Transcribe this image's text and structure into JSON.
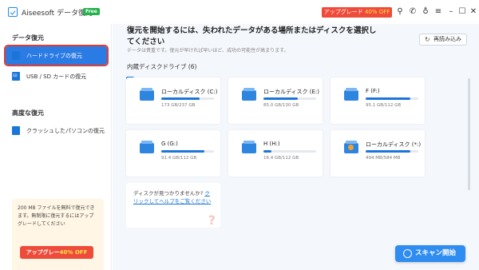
{
  "titlebar": {
    "app_title": "Aiseesoft データ復元",
    "free_badge": "Free",
    "upgrade_main": "アップグレード",
    "upgrade_offer": "40% OFF"
  },
  "sidebar": {
    "data_recovery_heading": "データ復元",
    "items": [
      {
        "label": "ハードドライブの復元",
        "icon": "hard-drive-icon"
      },
      {
        "label": "USB / SD カードの復元",
        "icon": "sd-card-icon"
      }
    ],
    "advanced_heading": "高度な復元",
    "advanced_items": [
      {
        "label": "クラッシュしたパソコンの復元",
        "icon": "crashed-pc-icon"
      }
    ],
    "promo": {
      "text": "200 MB ファイルを無料で復元できます。無制限に復元するにはアップグレードしてください",
      "button_main": "アップグレー",
      "button_offer": "40% OFF"
    }
  },
  "main": {
    "title": "復元を開始するには、失われたデータがある場所またはディスクを選択してください",
    "subtitle": "データは貴重です。復元が早ければ早いほど、成功の可能性が高まります。",
    "rescan_label": "再読み込み",
    "section_label": "内蔵ディスクドライブ (6)",
    "drives": [
      {
        "name": "ローカルディスク (C:)",
        "size": "173 GB/237 GB",
        "used_fraction": 0.73,
        "icon": "system-drive-icon"
      },
      {
        "name": "ローカルディスク (E:)",
        "size": "85.0 GB/130 GB",
        "used_fraction": 0.65,
        "icon": "drive-icon"
      },
      {
        "name": "F (F:)",
        "size": "95.1 GB/112 GB",
        "used_fraction": 0.85,
        "icon": "drive-icon"
      },
      {
        "name": "G (G:)",
        "size": "91.4 GB/112 GB",
        "used_fraction": 0.82,
        "icon": "drive-icon"
      },
      {
        "name": "H (H:)",
        "size": "16.4 GB/112 GB",
        "used_fraction": 0.15,
        "icon": "drive-icon"
      },
      {
        "name": "ローカルディスク (*:)",
        "size": "494 MB/584 MB",
        "used_fraction": 0.85,
        "icon": "recovery-drive-icon"
      }
    ],
    "help": {
      "text": "ディスクが見つかりませんか?",
      "link": "クリックしてヘルプをご覧ください"
    },
    "scan_button": "スキャン開始"
  }
}
